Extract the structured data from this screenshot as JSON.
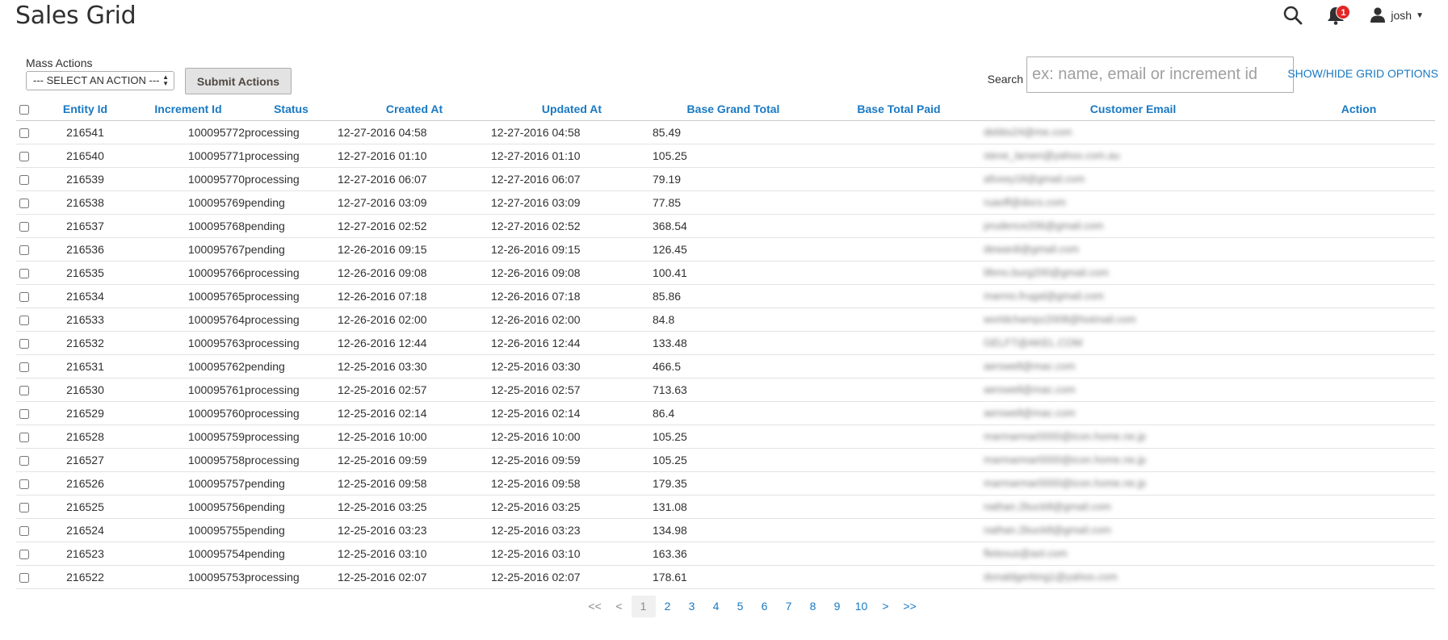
{
  "page": {
    "title": "Sales Grid"
  },
  "header": {
    "user_name": "josh",
    "notification_count": "1",
    "icons": [
      "search-icon",
      "bell-icon",
      "user-icon",
      "caret-down-icon"
    ]
  },
  "toolbar": {
    "mass_actions_label": "Mass Actions",
    "mass_actions_selected": "--- SELECT AN ACTION ---",
    "submit_label": "Submit Actions",
    "search_label": "Search",
    "search_placeholder": "ex: name, email or increment id",
    "grid_options_label": "SHOW/HIDE GRID OPTIONS"
  },
  "grid": {
    "headers": [
      "Entity Id",
      "Increment Id",
      "Status",
      "Created At",
      "Updated At",
      "Base Grand Total",
      "Base Total Paid",
      "Customer Email",
      "Action"
    ],
    "rows": [
      [
        "216541",
        "100095772",
        "processing",
        "12-27-2016 04:58",
        "12-27-2016 04:58",
        "85.49",
        "",
        "debbs24@me.com",
        ""
      ],
      [
        "216540",
        "100095771",
        "processing",
        "12-27-2016 01:10",
        "12-27-2016 01:10",
        "105.25",
        "",
        "steve_larsen@yahoo.com.au",
        ""
      ],
      [
        "216539",
        "100095770",
        "processing",
        "12-27-2016 06:07",
        "12-27-2016 06:07",
        "79.19",
        "",
        "afoxey18@gmail.com",
        ""
      ],
      [
        "216538",
        "100095769",
        "pending",
        "12-27-2016 03:09",
        "12-27-2016 03:09",
        "77.85",
        "",
        "ruaoff@docs.com",
        ""
      ],
      [
        "216537",
        "100095768",
        "pending",
        "12-27-2016 02:52",
        "12-27-2016 02:52",
        "368.54",
        "",
        "prudence206@gmail.com",
        ""
      ],
      [
        "216536",
        "100095767",
        "pending",
        "12-26-2016 09:15",
        "12-26-2016 09:15",
        "126.45",
        "",
        "dewardi@gmail.com",
        ""
      ],
      [
        "216535",
        "100095766",
        "processing",
        "12-26-2016 09:08",
        "12-26-2016 09:08",
        "100.41",
        "",
        "lifeno.burg200@gmail.com",
        ""
      ],
      [
        "216534",
        "100095765",
        "processing",
        "12-26-2016 07:18",
        "12-26-2016 07:18",
        "85.86",
        "",
        "marmo.frugal@gmail.com",
        ""
      ],
      [
        "216533",
        "100095764",
        "processing",
        "12-26-2016 02:00",
        "12-26-2016 02:00",
        "84.8",
        "",
        "worldchampz2008@hotmail.com",
        ""
      ],
      [
        "216532",
        "100095763",
        "processing",
        "12-26-2016 12:44",
        "12-26-2016 12:44",
        "133.48",
        "",
        "GELFT@AKEL.COM",
        ""
      ],
      [
        "216531",
        "100095762",
        "pending",
        "12-25-2016 03:30",
        "12-25-2016 03:30",
        "466.5",
        "",
        "aerswell@mac.com",
        ""
      ],
      [
        "216530",
        "100095761",
        "processing",
        "12-25-2016 02:57",
        "12-25-2016 02:57",
        "713.63",
        "",
        "aerswell@mac.com",
        ""
      ],
      [
        "216529",
        "100095760",
        "processing",
        "12-25-2016 02:14",
        "12-25-2016 02:14",
        "86.4",
        "",
        "aerswell@mac.com",
        ""
      ],
      [
        "216528",
        "100095759",
        "processing",
        "12-25-2016 10:00",
        "12-25-2016 10:00",
        "105.25",
        "",
        "marmarmar0000@icon.home.ne.jp",
        ""
      ],
      [
        "216527",
        "100095758",
        "processing",
        "12-25-2016 09:59",
        "12-25-2016 09:59",
        "105.25",
        "",
        "marmarmar0000@icon.home.ne.jp",
        ""
      ],
      [
        "216526",
        "100095757",
        "pending",
        "12-25-2016 09:58",
        "12-25-2016 09:58",
        "179.35",
        "",
        "marmarmar0000@icon.home.ne.jp",
        ""
      ],
      [
        "216525",
        "100095756",
        "pending",
        "12-25-2016 03:25",
        "12-25-2016 03:25",
        "131.08",
        "",
        "nathan.2buck8@gmail.com",
        ""
      ],
      [
        "216524",
        "100095755",
        "pending",
        "12-25-2016 03:23",
        "12-25-2016 03:23",
        "134.98",
        "",
        "nathan.2buck8@gmail.com",
        ""
      ],
      [
        "216523",
        "100095754",
        "pending",
        "12-25-2016 03:10",
        "12-25-2016 03:10",
        "163.36",
        "",
        "fletexus@aol.com",
        ""
      ],
      [
        "216522",
        "100095753",
        "processing",
        "12-25-2016 02:07",
        "12-25-2016 02:07",
        "178.61",
        "",
        "donaldgerking1@yahoo.com",
        ""
      ]
    ]
  },
  "pager": {
    "first": "<<",
    "prev": "<",
    "pages": [
      "1",
      "2",
      "3",
      "4",
      "5",
      "6",
      "7",
      "8",
      "9",
      "10"
    ],
    "current": "1",
    "next": ">",
    "last": ">>"
  },
  "colors": {
    "accent": "#1979c3",
    "badge": "#e22626",
    "text": "#303030",
    "button_bg": "#e3e3e3"
  }
}
